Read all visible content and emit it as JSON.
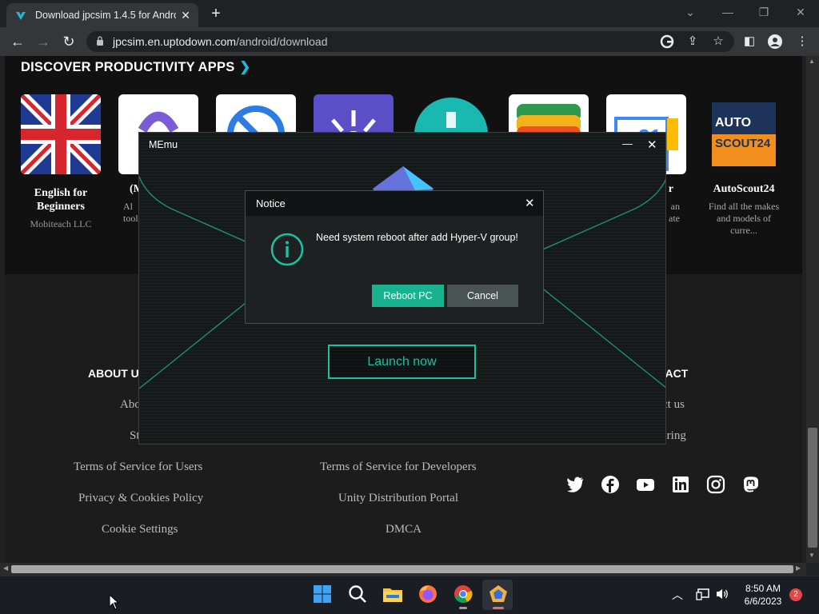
{
  "browser": {
    "tab_title": "Download jpcsim 1.4.5 for Android",
    "tab_close": "✕",
    "new_tab": "+",
    "url_host": "jpcsim.en.uptodown.com",
    "url_path": "/android/download"
  },
  "page": {
    "section_heading": "DISCOVER PRODUCTIVITY APPS",
    "apps": [
      {
        "name": "English for Beginners",
        "developer": "Mobiteach LLC"
      },
      {
        "name": "(M",
        "description": "Al\ntool"
      },
      {
        "name": "",
        "description": ""
      },
      {
        "name": "",
        "description": ""
      },
      {
        "name": "",
        "description": ""
      },
      {
        "name": "",
        "description": ""
      },
      {
        "name": "r",
        "description": "an\nate"
      },
      {
        "name": "AutoScout24",
        "description": "Find all the makes and models of curre..."
      }
    ],
    "autoscout_logo_line1": "AUTO",
    "autoscout_logo_line2": "SCOUT24",
    "footer": {
      "about_heading": "ABOUT U",
      "contact_heading": "TACT",
      "about_link_partial": "Abo",
      "st_partial": "St",
      "contact_link_partial": "ct us",
      "hiring_partial": "hiring",
      "terms_users": "Terms of Service for Users",
      "privacy": "Privacy & Cookies Policy",
      "cookie_settings": "Cookie Settings",
      "terms_devs": "Terms of Service for Developers",
      "unity": "Unity Distribution Portal",
      "dmca": "DMCA"
    }
  },
  "memu": {
    "title": "MEmu",
    "minimize": "—",
    "close": "✕",
    "launch_label": "Launch now"
  },
  "notice": {
    "title": "Notice",
    "close": "✕",
    "message": "Need system reboot after add Hyper-V group!",
    "reboot_label": "Reboot PC",
    "cancel_label": "Cancel"
  },
  "taskbar": {
    "time": "8:50 AM",
    "date": "6/6/2023",
    "notification_count": "2"
  }
}
